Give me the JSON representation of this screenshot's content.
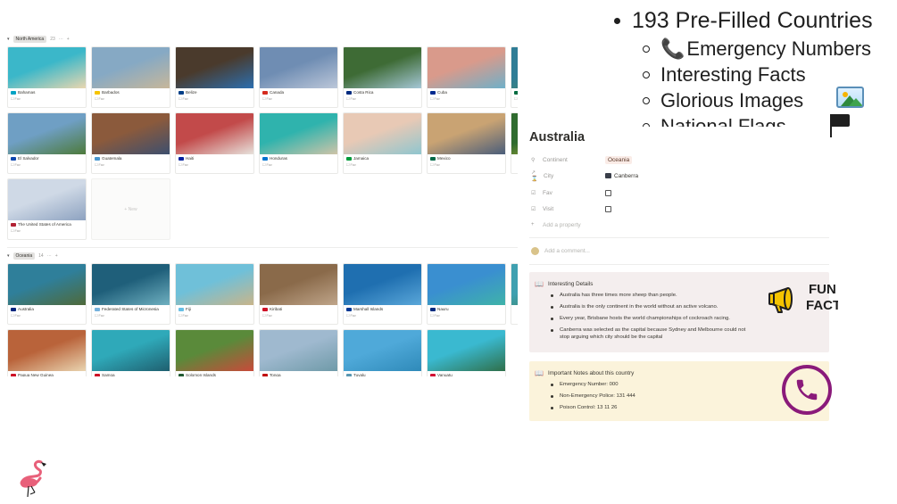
{
  "features": {
    "headline": "193 Pre-Filled Countries",
    "items": [
      {
        "glyph": "📞",
        "label": "Emergency Numbers"
      },
      {
        "glyph": "",
        "label": "Interesting Facts"
      },
      {
        "glyph": "",
        "label": "Glorious Images"
      },
      {
        "glyph": "",
        "label": "National Flags"
      }
    ]
  },
  "groups": [
    {
      "name": "North America",
      "count": "23",
      "dots": "···",
      "plus": "+",
      "new_label": "+ New",
      "cards": [
        {
          "name": "Bahamas",
          "fav": "Fav",
          "img": "#3bb7c9",
          "img2": "#e9d7b0",
          "flag": "#00a3c4"
        },
        {
          "name": "Barbados",
          "fav": "Fav",
          "img": "#86a9c4",
          "img2": "#c7b79a",
          "flag": "#f6c400"
        },
        {
          "name": "Belize",
          "fav": "Fav",
          "img": "#4a3a2c",
          "img2": "#2c6fb0",
          "flag": "#003f87"
        },
        {
          "name": "Canada",
          "fav": "Fav",
          "img": "#6f8db3",
          "img2": "#bcc7d9",
          "flag": "#d52b1e"
        },
        {
          "name": "Costa Rica",
          "fav": "Fav",
          "img": "#3e6b35",
          "img2": "#a5c7d6",
          "flag": "#002b7f"
        },
        {
          "name": "Cuba",
          "fav": "Fav",
          "img": "#d99a8b",
          "img2": "#6fb0c9",
          "flag": "#002a8f"
        },
        {
          "name": "Dominica",
          "fav": "Fav",
          "img": "#2f7d96",
          "img2": "#4c8a5a",
          "flag": "#006b3f"
        },
        {
          "name": "El Salvador",
          "fav": "Fav",
          "img": "#6f9fc4",
          "img2": "#4d7a3b",
          "flag": "#0f47af"
        },
        {
          "name": "Guatemala",
          "fav": "Fav",
          "img": "#8b5a3c",
          "img2": "#3d4f6e",
          "flag": "#4997d0"
        },
        {
          "name": "Haiti",
          "fav": "Fav",
          "img": "#c24a4a",
          "img2": "#e7e2dc",
          "flag": "#00209f"
        },
        {
          "name": "Honduras",
          "fav": "Fav",
          "img": "#2fb3ad",
          "img2": "#cfc4a8",
          "flag": "#0073cf"
        },
        {
          "name": "Jamaica",
          "fav": "Fav",
          "img": "#e8c9b5",
          "img2": "#8fc6cf",
          "flag": "#009b3a"
        },
        {
          "name": "Mexico",
          "fav": "Fav",
          "img": "#c9a373",
          "img2": "#4a5d7a",
          "flag": "#006847"
        },
        {
          "name": "",
          "fav": "",
          "img": "#2f6b2f",
          "img2": "#d9c23a",
          "flag": "#ffffff"
        },
        {
          "name": "The United States of America",
          "fav": "Fav",
          "img": "#cfd9e6",
          "img2": "#8da2c0",
          "flag": "#b22234"
        }
      ]
    },
    {
      "name": "Oceania",
      "count": "14",
      "dots": "···",
      "plus": "+",
      "cards": [
        {
          "name": "Australia",
          "fav": "Fav",
          "img": "#2f7f9a",
          "img2": "#4f6a3a",
          "flag": "#00247d"
        },
        {
          "name": "Federated States of Micronesia",
          "fav": "Fav",
          "img": "#1f5f7a",
          "img2": "#6fb0c0",
          "flag": "#75b2dd"
        },
        {
          "name": "Fiji",
          "fav": "Fav",
          "img": "#6fc0d9",
          "img2": "#c9b58a",
          "flag": "#68bfe5"
        },
        {
          "name": "Kiribati",
          "fav": "Fav",
          "img": "#8a6a4a",
          "img2": "#bfa58a",
          "flag": "#ce1126"
        },
        {
          "name": "Marshall Islands",
          "fav": "Fav",
          "img": "#1f6fb0",
          "img2": "#5aa7d9",
          "flag": "#003893"
        },
        {
          "name": "Nauru",
          "fav": "Fav",
          "img": "#3a8fd0",
          "img2": "#3fb3a9",
          "flag": "#002b7f"
        },
        {
          "name": "",
          "fav": "",
          "img": "#3fa0b0",
          "img2": "#3a7a4a",
          "flag": "#ffffff"
        },
        {
          "name": "Papua New Guinea",
          "fav": "Fav",
          "img": "#b9633a",
          "img2": "#e9d4b0",
          "flag": "#ce1126"
        },
        {
          "name": "Samoa",
          "fav": "Fav",
          "img": "#2fa9b9",
          "img2": "#1f5f6f",
          "flag": "#ce1126"
        },
        {
          "name": "Solomon Islands",
          "fav": "Fav",
          "img": "#5a8a3a",
          "img2": "#c94a3a",
          "flag": "#215b33"
        },
        {
          "name": "Tonga",
          "fav": "Fav",
          "img": "#9fb9cf",
          "img2": "#6f9aa8",
          "flag": "#c10000"
        },
        {
          "name": "Tuvalu",
          "fav": "Fav",
          "img": "#4fa9d9",
          "img2": "#2f8ab9",
          "flag": "#5b97b1"
        },
        {
          "name": "Vanuatu",
          "fav": "Fav",
          "img": "#3ab9d0",
          "img2": "#2f6f4a",
          "flag": "#d21034"
        }
      ]
    }
  ],
  "record": {
    "title": "Australia",
    "properties": [
      {
        "icon": "⚲",
        "label": "Continent",
        "type": "chip",
        "value": "Oceania"
      },
      {
        "icon": "↗ ⌛",
        "label": "City",
        "type": "link",
        "value": "Canberra"
      },
      {
        "icon": "☑",
        "label": "Fav",
        "type": "checkbox",
        "value": ""
      },
      {
        "icon": "☑",
        "label": "Visit",
        "type": "checkbox",
        "value": ""
      }
    ],
    "add_property": "Add a property",
    "add_comment": "Add a comment...",
    "facts": {
      "heading": "Interesting Details",
      "items": [
        "Australia has three times more sheep than people.",
        "Australia is the only continent in the world without an active volcano.",
        "Every year, Brisbane hosts the world championships of cockroach racing.",
        "Canberra was selected as the capital because Sydney and Melbourne could not stop arguing which city should be the capital"
      ],
      "badge_line1": "FUN",
      "badge_line2": "FACT"
    },
    "notes": {
      "heading": "Important Notes about this country",
      "items": [
        "Emergency Number: 000",
        "Non-Emergency Police: 131 444",
        "Poison Control: 13 11 26"
      ]
    }
  },
  "icons": {
    "pictures": "framed-picture-icon",
    "flags": "black-flag-icon",
    "logo": "flamingo-icon"
  },
  "colors": {
    "chip_bg": "#faece7",
    "facts_bg": "#f4eeee",
    "notes_bg": "#fbf3db",
    "phone": "#8a1a7a",
    "flamingo": "#e8607a"
  }
}
